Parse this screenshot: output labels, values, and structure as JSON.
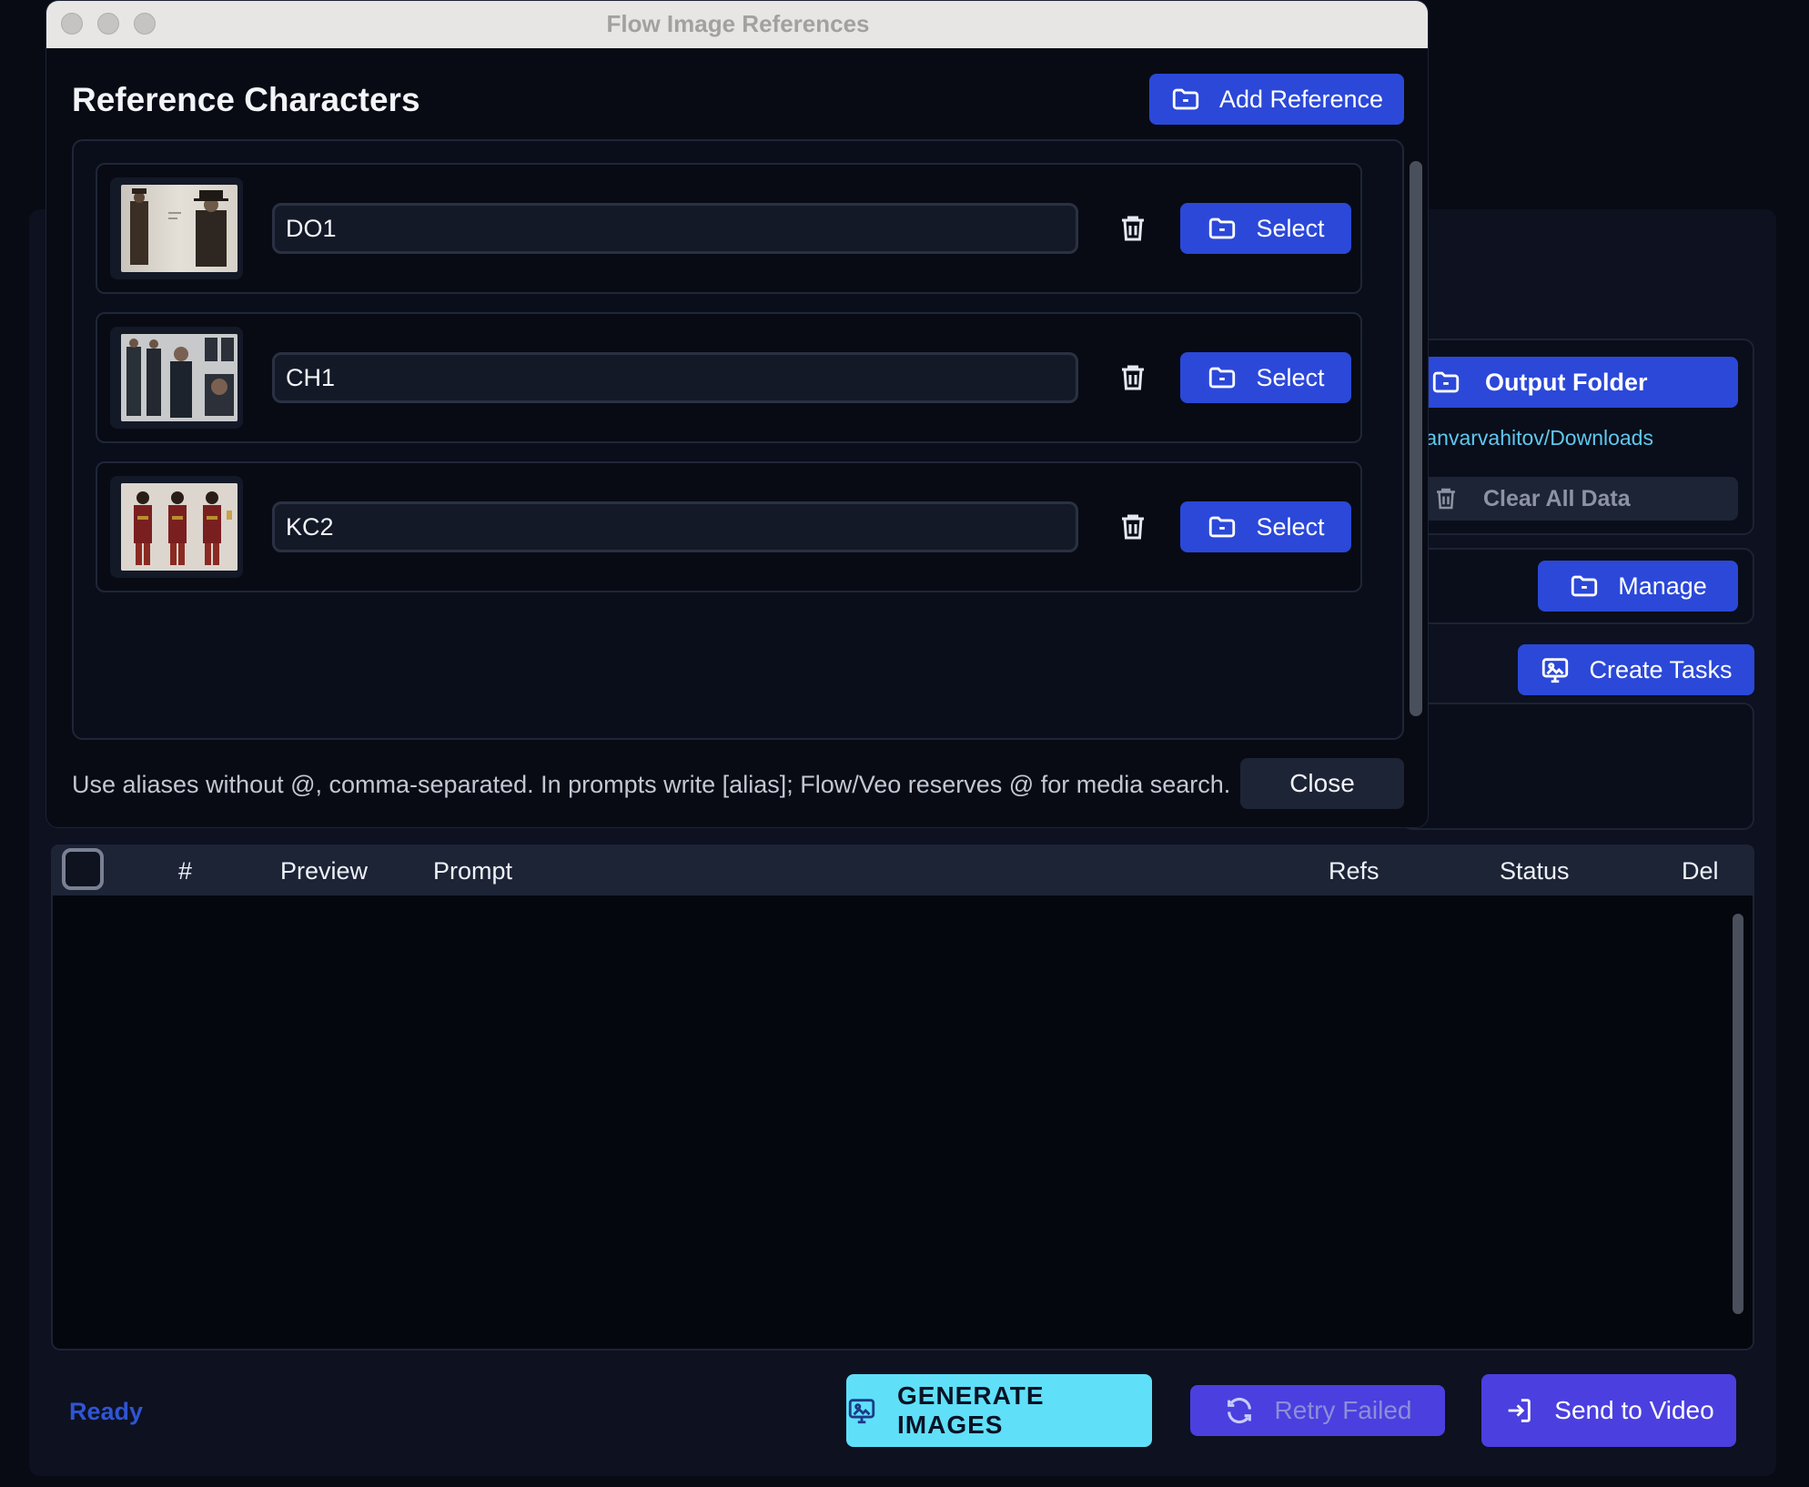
{
  "window": {
    "title": "Flow Image References"
  },
  "modal": {
    "heading": "Reference Characters",
    "add_label": "Add Reference",
    "references": [
      {
        "alias": "DO1",
        "select_label": "Select",
        "thumb": "two characters in long coats and top hats"
      },
      {
        "alias": "CH1",
        "select_label": "Select",
        "thumb": "character turnaround sheet in dark coat"
      },
      {
        "alias": "KC2",
        "select_label": "Select",
        "thumb": "three figures in red and gold costumes"
      }
    ],
    "hint": "Use aliases without @, comma-separated. In prompts write [alias]; Flow/Veo reserves @ for media search.",
    "close_label": "Close"
  },
  "sidebar": {
    "output_folder_label": "Output Folder",
    "output_path": "/anvarvahitov/Downloads",
    "clear_label": "Clear All Data",
    "manage_label": "Manage",
    "create_tasks_label": "Create Tasks"
  },
  "table": {
    "columns": [
      "#",
      "Preview",
      "Prompt",
      "Refs",
      "Status",
      "Del"
    ],
    "rows": []
  },
  "footer": {
    "status": "Ready",
    "generate_label": "GENERATE IMAGES",
    "retry_label": "Retry Failed",
    "send_label": "Send to Video"
  },
  "colors": {
    "background": "#080b14",
    "accent_blue": "#2b48d8",
    "generate_cyan": "#5fe0f8",
    "violet": "#4b3fdf",
    "status_ready": "#2f55d4",
    "path_text": "#5fc8f0"
  }
}
